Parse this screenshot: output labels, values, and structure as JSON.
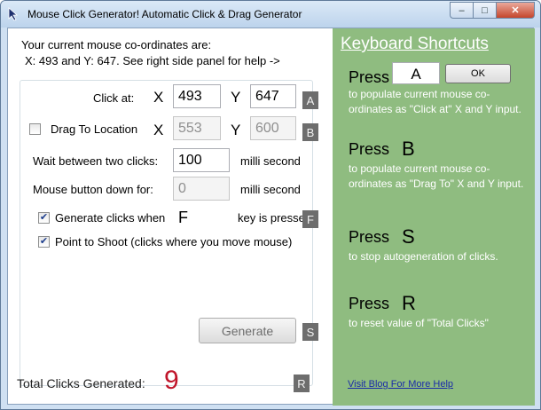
{
  "window": {
    "title": "Mouse Click Generator! Automatic Click & Drag Generator",
    "controls": {
      "minimize": "–",
      "maximize": "□",
      "close": "✕"
    }
  },
  "info": {
    "line1": "Your current mouse co-ordinates are:",
    "line2": "X: 493 and Y: 647. See right side panel for help ->"
  },
  "click_at": {
    "label": "Click at:",
    "x_label": "X",
    "x_value": "493",
    "y_label": "Y",
    "y_value": "647",
    "key": "A"
  },
  "drag": {
    "label": "Drag To Location",
    "checked": false,
    "x_label": "X",
    "x_value": "553",
    "y_label": "Y",
    "y_value": "600",
    "key": "B"
  },
  "wait": {
    "label": "Wait between two clicks:",
    "value": "100",
    "unit": "milli second"
  },
  "button_down": {
    "label": "Mouse button down for:",
    "value": "0",
    "unit": "milli second"
  },
  "gen_on_key": {
    "label": "Generate clicks when",
    "checked": true,
    "key_letter": "F",
    "suffix": "key is pressed",
    "key": "F"
  },
  "point_to_shoot": {
    "label": "Point to Shoot (clicks where you move mouse)",
    "checked": true
  },
  "generate": {
    "label": "Generate",
    "key": "S"
  },
  "total": {
    "label": "Total Clicks Generated:",
    "value": "9",
    "key": "R"
  },
  "shortcuts": {
    "title": "Keyboard Shortcuts",
    "press_label": "Press",
    "input_value": "A",
    "ok_label": "OK",
    "items": [
      {
        "key": "A",
        "desc": "to populate current mouse co-ordinates as \"Click at\" X and Y input."
      },
      {
        "key": "B",
        "desc": "to populate current mouse co-ordinates as \"Drag To\" X and Y input."
      },
      {
        "key": "S",
        "desc": "to stop autogeneration of clicks."
      },
      {
        "key": "R",
        "desc": "to reset value of \"Total Clicks\""
      }
    ],
    "blog_link": "Visit Blog For More Help"
  },
  "colors": {
    "panel_green": "#8fbc80",
    "total_red": "#c0152a",
    "key_badge": "#6d6d6d",
    "link_blue": "#1a2ba8"
  }
}
